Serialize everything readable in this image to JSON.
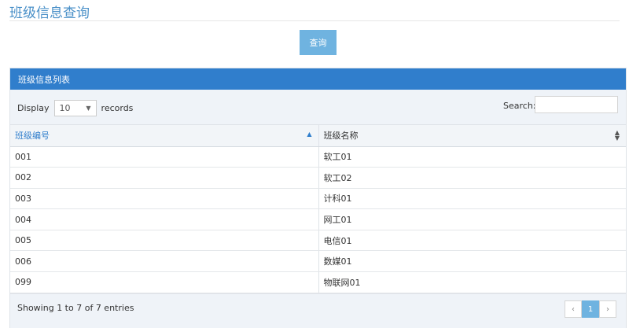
{
  "page": {
    "title": "班级信息查询",
    "query_button": "查询"
  },
  "panel": {
    "header": "班级信息列表",
    "length": {
      "prefix": "Display",
      "selected": "10",
      "suffix": "records"
    },
    "search_label": "Search:",
    "search_value": ""
  },
  "table": {
    "columns": [
      "班级编号",
      "班级名称"
    ],
    "rows": [
      [
        "001",
        "软工01"
      ],
      [
        "002",
        "软工02"
      ],
      [
        "003",
        "计科01"
      ],
      [
        "004",
        "网工01"
      ],
      [
        "005",
        "电信01"
      ],
      [
        "006",
        "数媒01"
      ],
      [
        "099",
        "物联网01"
      ]
    ]
  },
  "footer": {
    "info": "Showing 1 to 7 of 7 entries",
    "pages": [
      "1"
    ]
  },
  "colors": {
    "accent": "#307ecc",
    "button": "#6fb3e0",
    "title": "#4a90c8"
  }
}
